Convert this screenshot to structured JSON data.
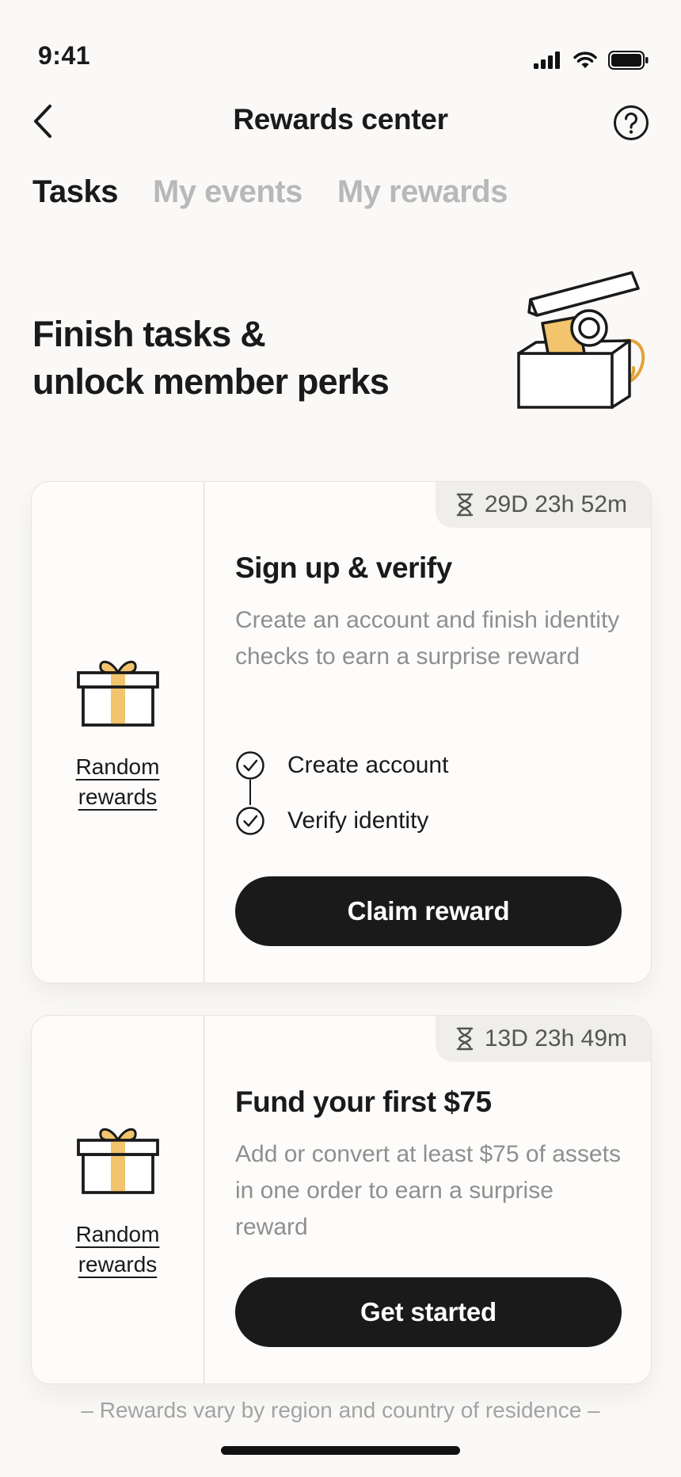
{
  "status_bar": {
    "time": "9:41"
  },
  "header": {
    "title": "Rewards center",
    "back_icon": "chevron-left-icon",
    "help_icon": "question-circle-icon"
  },
  "tabs": [
    {
      "label": "Tasks",
      "active": true
    },
    {
      "label": "My events",
      "active": false
    },
    {
      "label": "My rewards",
      "active": false
    }
  ],
  "hero": {
    "title_line1": "Finish tasks &",
    "title_line2": "unlock member perks"
  },
  "cards": [
    {
      "reward_label_line1": "Random",
      "reward_label_line2": "rewards",
      "timer": "29D 23h 52m",
      "title": "Sign up & verify",
      "description": "Create an account and finish identity checks to earn a surprise reward",
      "steps": [
        {
          "label": "Create account",
          "done": true
        },
        {
          "label": "Verify identity",
          "done": true
        }
      ],
      "button_label": "Claim reward"
    },
    {
      "reward_label_line1": "Random",
      "reward_label_line2": "rewards",
      "timer": "13D 23h 49m",
      "title": "Fund your first $75",
      "description": "Add or convert at least $75 of assets in one order to earn a surprise reward",
      "button_label": "Get started"
    }
  ],
  "footnote": "– Rewards vary by region and country of residence –",
  "colors": {
    "accent": "#f2c46d",
    "ink": "#1a1a1a",
    "muted": "#8f8f8f",
    "background": "#faf9f7"
  }
}
